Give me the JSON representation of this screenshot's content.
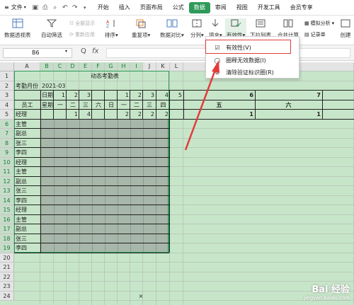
{
  "menu": {
    "file_label": "文件",
    "tabs": [
      "开始",
      "插入",
      "页面布局",
      "公式",
      "数据",
      "审阅",
      "视图",
      "开发工具",
      "会员专享"
    ],
    "active_tab": "数据"
  },
  "ribbon": {
    "pivot": "数据透视表",
    "autofilter": "自动筛选",
    "show_all": "全部显示",
    "reapply": "重新应用",
    "sort": "排序",
    "duplicates": "重复项",
    "compare": "数据对比",
    "split": "分列",
    "fill": "填充",
    "validity": "有效性",
    "dropdown_list": "下拉列表",
    "merge_calc": "合并计算",
    "simulate": "模拟分析",
    "record": "记录单",
    "create": "创建"
  },
  "formula_bar": {
    "cell_ref": "B6",
    "fx": "fx",
    "zoom_icon": "Q"
  },
  "dropdown": {
    "items": [
      "有效性(V)",
      "圈释无效数据(I)",
      "清除验证标识圈(R)"
    ]
  },
  "sheet": {
    "columns": [
      "A",
      "B",
      "C",
      "D",
      "E",
      "F",
      "G",
      "H",
      "I",
      "J",
      "K",
      "L",
      "M"
    ],
    "rows": [
      "1",
      "2",
      "3",
      "4",
      "5",
      "6",
      "7",
      "8",
      "9",
      "10",
      "11",
      "12",
      "13",
      "14",
      "15",
      "16",
      "17",
      "18",
      "19",
      "20",
      "21",
      "22",
      "23",
      "24"
    ],
    "title": "动态考勤表",
    "month_label": "考勤月份",
    "month_value": "2021-03",
    "date_label": "日期",
    "weekday_label": "星期",
    "staff_label": "员工",
    "date_cells": [
      "1",
      "2",
      "3",
      "1",
      "2",
      "3",
      "4",
      "5",
      "6",
      "7"
    ],
    "weekday_cells": [
      "一",
      "二",
      "三",
      "六",
      "日",
      "一",
      "二",
      "三",
      "四",
      "五",
      "六"
    ],
    "row5_values": [
      "1",
      "4",
      "2",
      "2",
      "2",
      "2",
      "1",
      "1"
    ],
    "row5_name": "经理",
    "names": [
      "主管",
      "副总",
      "张三",
      "李四",
      "经理",
      "主管",
      "副总",
      "张三",
      "李四",
      "经理",
      "主管",
      "副总",
      "张三",
      "李四"
    ],
    "stray_mark": "×"
  },
  "watermark": {
    "brand": "Bai 经验",
    "url": "jingyan.baidu.com"
  },
  "colors": {
    "accent": "#2e9a5a",
    "highlight": "#e23b3b",
    "sheet_bg": "#c7e6c9"
  }
}
